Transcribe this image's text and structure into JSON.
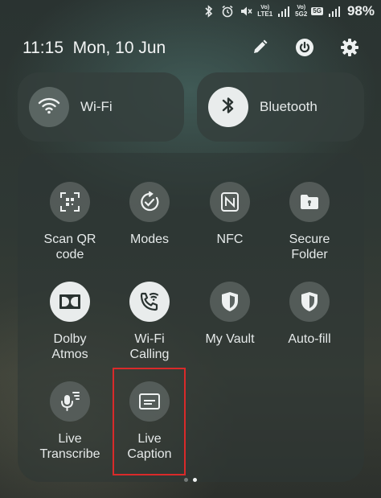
{
  "status_bar": {
    "net1": {
      "top": "Vo)",
      "bottom": "LTE1"
    },
    "net2": {
      "top": "Vo)",
      "bottom": "5G2"
    },
    "badge_5g": "5G",
    "battery": "98%"
  },
  "header": {
    "time_date": "11:15  Mon, 10 Jun"
  },
  "toggles": {
    "wifi": {
      "label": "Wi-Fi",
      "active": false
    },
    "bluetooth": {
      "label": "Bluetooth",
      "active": true
    }
  },
  "tiles": [
    {
      "line1": "Scan QR",
      "line2": "code",
      "icon": "qr-scan-icon"
    },
    {
      "line1": "Modes",
      "line2": "",
      "icon": "modes-icon"
    },
    {
      "line1": "NFC",
      "line2": "",
      "icon": "nfc-icon"
    },
    {
      "line1": "Secure",
      "line2": "Folder",
      "icon": "secure-folder-icon"
    },
    {
      "line1": "Dolby",
      "line2": "Atmos",
      "icon": "dolby-icon"
    },
    {
      "line1": "Wi-Fi",
      "line2": "Calling",
      "icon": "wifi-calling-icon"
    },
    {
      "line1": "My Vault",
      "line2": "",
      "icon": "shield-icon"
    },
    {
      "line1": "Auto-fill",
      "line2": "",
      "icon": "shield-icon"
    },
    {
      "line1": "Live",
      "line2": "Transcribe",
      "icon": "transcribe-icon"
    },
    {
      "line1": "Live",
      "line2": "Caption",
      "icon": "caption-icon"
    }
  ],
  "colors": {
    "highlight_border": "#d92a2a",
    "active_tile": "#e9ecec",
    "inactive_tile": "#5c6462"
  }
}
